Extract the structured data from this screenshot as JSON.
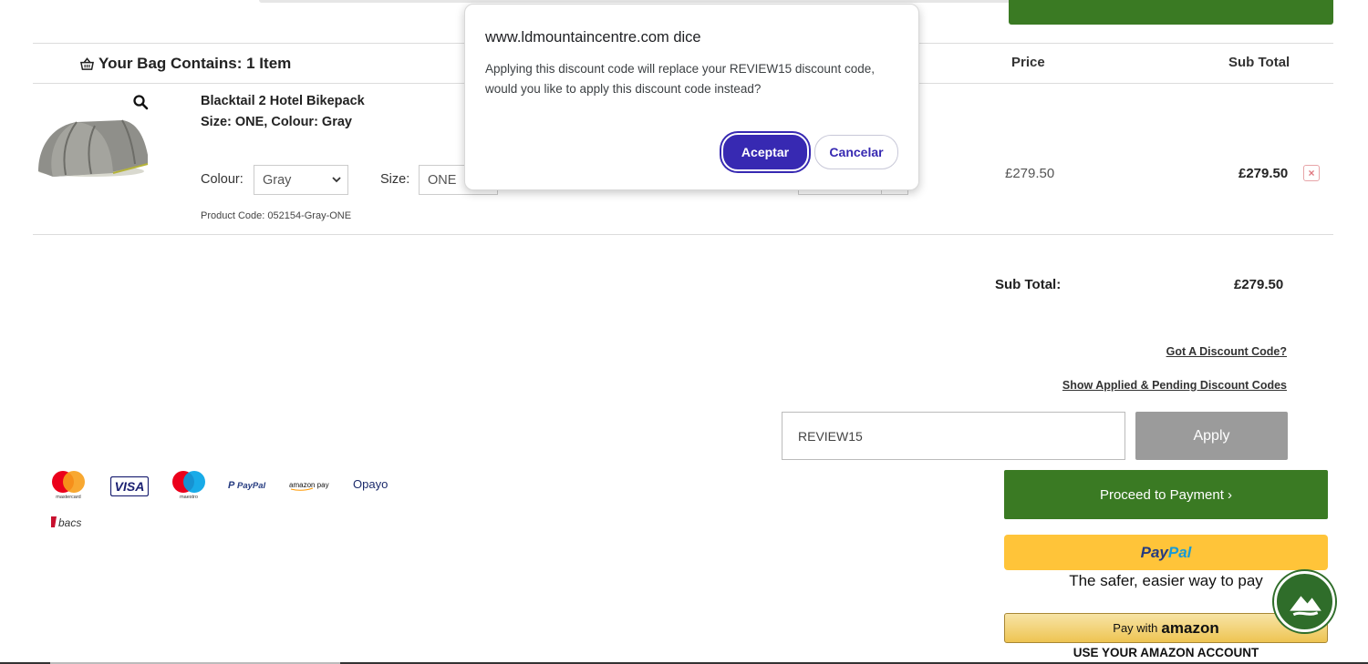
{
  "dialog": {
    "title": "www.ldmountaincentre.com dice",
    "message": "Applying this discount code will replace your REVIEW15 discount code, would you like to apply this discount code instead?",
    "ok_label": "Aceptar",
    "cancel_label": "Cancelar",
    "ok_color": "#3729b2"
  },
  "bag": {
    "title": "Your Bag Contains: 1 Item",
    "icon": "basket-icon",
    "col_price": "Price",
    "col_subtotal": "Sub Total"
  },
  "item": {
    "name": "Blacktail 2 Hotel Bikepack",
    "meta": "Size: ONE, Colour: Gray",
    "colour_label": "Colour:",
    "colour_value": "Gray",
    "size_label": "Size:",
    "size_value": "ONE",
    "product_code": "Product Code: 052154-Gray-ONE",
    "price": "£279.50",
    "subtotal": "£279.50",
    "remove_icon": "close-icon"
  },
  "totals": {
    "subtotal_label": "Sub Total:",
    "subtotal_value": "£279.50"
  },
  "discount": {
    "got_code_link": "Got A Discount Code?",
    "show_codes_link": "Show Applied & Pending Discount Codes",
    "code_value": "REVIEW15",
    "apply_label": "Apply"
  },
  "checkout": {
    "proceed_label": "Proceed to Payment ›",
    "paypal_part1": "Pay",
    "paypal_part2": "Pal",
    "paypal_tagline": "The safer, easier way to pay",
    "amazon_prefix": "Pay with",
    "amazon_brand": "amazon",
    "amazon_tagline": "USE YOUR AMAZON ACCOUNT",
    "brand_green": "#3a7a23",
    "paypal_yellow": "#ffc439"
  },
  "payment_methods": {
    "mastercard": "mastercard",
    "visa": "VISA",
    "maestro": "maestro",
    "paypal_p": "P",
    "paypal_word": "PayPal",
    "amazonpay": "amazon pay",
    "opayo": "Opayo",
    "bacs": "bacs"
  }
}
